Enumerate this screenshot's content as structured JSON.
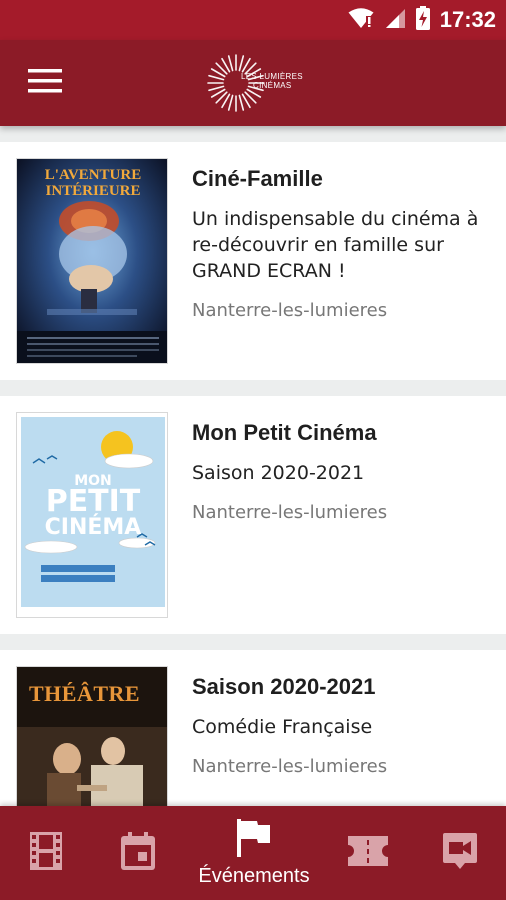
{
  "status_bar": {
    "time": "17:32"
  },
  "header": {
    "logo_line1": "LES LUMIÈRES",
    "logo_line2": "CINÉMAS"
  },
  "events": [
    {
      "title": "Ciné-Famille",
      "subtitle": "Un indispensable du cinéma à re-découvrir en famille sur GRAND ECRAN !",
      "venue": "Nanterre-les-lumieres",
      "poster_text": "L'AVENTURE INTÉRIEURE"
    },
    {
      "title": "Mon Petit Cinéma",
      "subtitle": "Saison 2020-2021",
      "venue": "Nanterre-les-lumieres",
      "poster_line1": "MON",
      "poster_line2": "PETIT",
      "poster_line3": "CINÉMA"
    },
    {
      "title": "Saison 2020-2021",
      "subtitle": "Comédie Française",
      "venue": "Nanterre-les-lumieres",
      "poster_text": "THÉÂTRE"
    }
  ],
  "bottom_nav": {
    "active_label": "Événements",
    "active_index": 2
  },
  "colors": {
    "primary": "#8c1b27",
    "status_bar": "#a41b2a",
    "background": "#eceeee"
  }
}
